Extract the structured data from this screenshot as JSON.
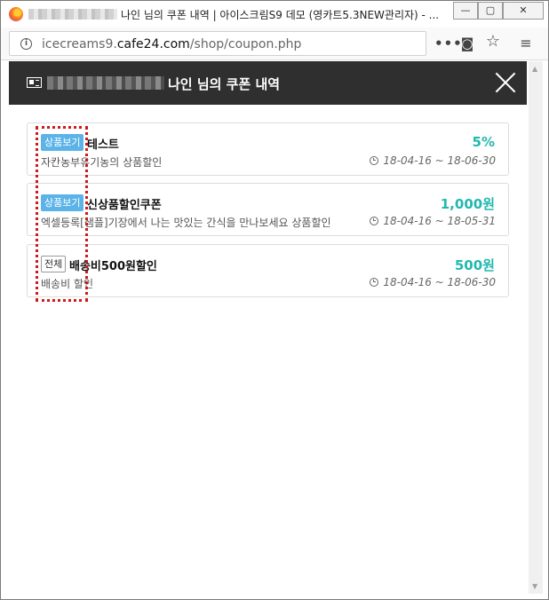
{
  "window": {
    "title": "나인 님의 쿠폰 내역 | 아이스크림S9 데모 (영카트5.3NEW관리자) - ...",
    "controls": {
      "minimize": "—",
      "maximize": "▢",
      "close": "✕"
    }
  },
  "addressbar": {
    "url_prefix": "icecreams9.",
    "url_host": "cafe24.com",
    "url_path": "/shop/coupon.php"
  },
  "icons": {
    "more": "•••",
    "pocket": "◙",
    "star": "☆",
    "menu": "≡",
    "scroll_up": "▲",
    "scroll_down": "▼"
  },
  "popup": {
    "title": "나인 님의 쿠폰 내역"
  },
  "coupons": [
    {
      "tag": "상품보기",
      "tag_type": "product",
      "name": "테스트",
      "desc": "자칸농부유기농의 상품할인",
      "amount": "5%",
      "period": "18-04-16 ~ 18-06-30"
    },
    {
      "tag": "상품보기",
      "tag_type": "product",
      "name": "신상품할인쿠폰",
      "desc": "엑셀등록[샘플]기장에서 나는 맛있는 간식을 만나보세요 상품할인",
      "amount": "1,000원",
      "period": "18-04-16 ~ 18-05-31"
    },
    {
      "tag": "전체",
      "tag_type": "all",
      "name": "배송비500원할인",
      "desc": "배송비 할인",
      "amount": "500원",
      "period": "18-04-16 ~ 18-06-30"
    }
  ],
  "colors": {
    "amount": "#22b8b0",
    "product_tag": "#5bb3e8",
    "header_bg": "#2f2f2f",
    "highlight": "#cc1a1a"
  }
}
